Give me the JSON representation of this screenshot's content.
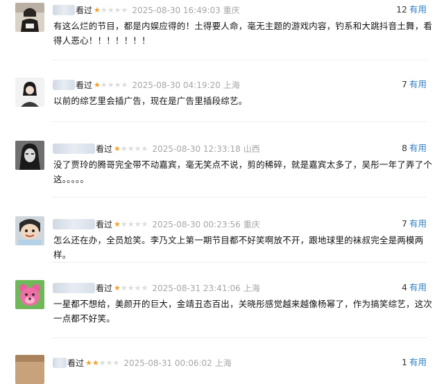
{
  "reviews": [
    {
      "seen": "看过",
      "rating": 1,
      "time": "2025-08-30 16:49:03",
      "location": "重庆",
      "useful_count": "12",
      "useful_label": "有用",
      "text": "有这么烂的节目，都是内娱应得的！土得要人命，毫无主题的游戏内容，钓系和大跳抖音土舞，看得人恶心！！！！！！！"
    },
    {
      "seen": "看过",
      "rating": 1,
      "time": "2025-08-30 04:19:20",
      "location": "上海",
      "useful_count": "7",
      "useful_label": "有用",
      "text": "以前的综艺里会插广告，现在是广告里插段综艺。"
    },
    {
      "seen": "看过",
      "rating": 1,
      "time": "2025-08-30 12:33:18",
      "location": "山西",
      "useful_count": "8",
      "useful_label": "有用",
      "text": "没了贾玲的腾哥完全带不动嘉宾，毫无笑点不说，剪的稀碎，就是嘉宾太多了，吴彤一年了弄了个这。。。。。"
    },
    {
      "seen": "看过",
      "rating": 1,
      "time": "2025-08-30 00:23:56",
      "location": "重庆",
      "useful_count": "7",
      "useful_label": "有用",
      "text": "怎么还在办，全员尬笑。李乃文上第一期节目都不好笑啊放不开，跟地球里的袜叔完全是两模两样。"
    },
    {
      "seen": "看过",
      "rating": 1,
      "time": "2025-08-31 23:41:06",
      "location": "上海",
      "useful_count": "4",
      "useful_label": "有用",
      "text": "一星都不想给，美颜开的巨大，金靖丑态百出，关晓彤感觉越来越像杨幂了，作为搞笑综艺，这次一点都不好笑。"
    },
    {
      "seen": "看过",
      "rating": 2,
      "time": "2025-08-31 00:06:02",
      "location": "上海",
      "useful_count": "1",
      "useful_label": "有用",
      "text": ""
    }
  ],
  "icons": {
    "star": "star-icon"
  },
  "colors": {
    "star_on": "#f0a22b",
    "star_off": "#dcdcdc",
    "link": "#2f7fc4",
    "meta": "#a6a6a6"
  }
}
